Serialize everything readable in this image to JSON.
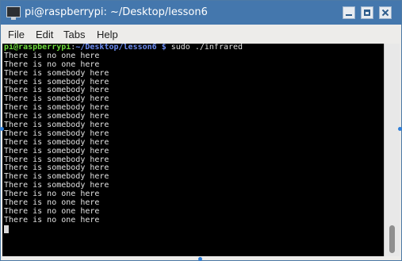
{
  "window": {
    "title": "pi@raspberrypi: ~/Desktop/lesson6",
    "icon": "terminal-icon"
  },
  "menubar": {
    "items": [
      "File",
      "Edit",
      "Tabs",
      "Help"
    ]
  },
  "terminal": {
    "prompt": {
      "user_host": "pi@raspberrypi",
      "separator": ":",
      "path": "~/Desktop/lesson6 $",
      "command": " sudo ./infrared"
    },
    "output": [
      "There is no one here",
      "There is no one here",
      "There is somebody here",
      "There is somebody here",
      "There is somebody here",
      "There is somebody here",
      "There is somebody here",
      "There is somebody here",
      "There is somebody here",
      "There is somebody here",
      "There is somebody here",
      "There is somebody here",
      "There is somebody here",
      "There is somebody here",
      "There is somebody here",
      "There is somebody here",
      "There is no one here",
      "There is no one here",
      "There is no one here",
      "There is no one here"
    ]
  },
  "colors": {
    "titlebar": "#4477ad",
    "prompt_user": "#6edc3c",
    "prompt_path": "#6c8cf2",
    "terminal_bg": "#000000",
    "terminal_fg": "#e0e0e0"
  }
}
